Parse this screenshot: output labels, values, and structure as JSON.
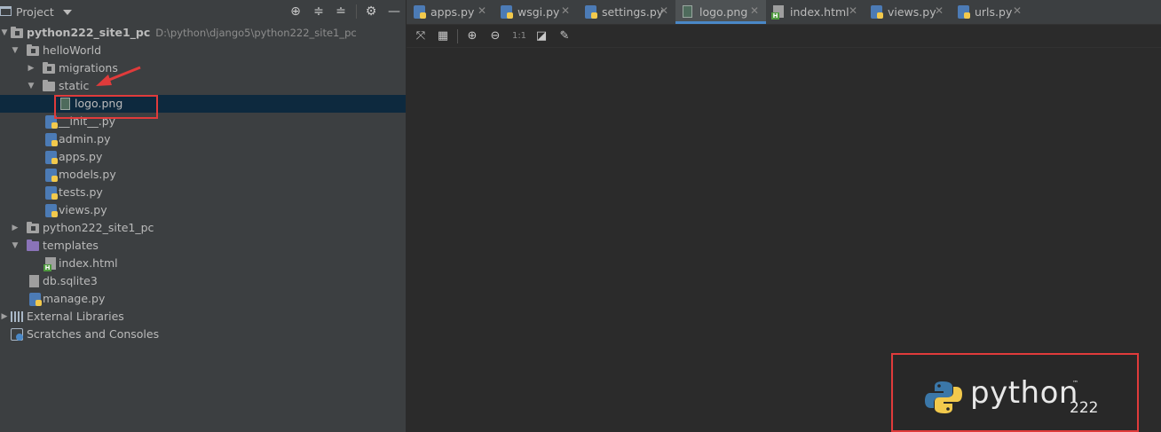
{
  "project_panel": {
    "title": "Project",
    "tree": {
      "root": {
        "label": "python222_site1_pc",
        "path": "D:\\python\\django5\\python222_site1_pc"
      },
      "hello_world": "helloWorld",
      "migrations": "migrations",
      "static": "static",
      "logo": "logo.png",
      "init": "__init__.py",
      "admin": "admin.py",
      "apps": "apps.py",
      "models": "models.py",
      "tests": "tests.py",
      "views": "views.py",
      "site_pkg": "python222_site1_pc",
      "templates": "templates",
      "index": "index.html",
      "db": "db.sqlite3",
      "manage": "manage.py",
      "external_libraries": "External Libraries",
      "scratches": "Scratches and Consoles"
    }
  },
  "editor": {
    "tabs": [
      {
        "label": "apps.py",
        "icon": "python-file-icon"
      },
      {
        "label": "wsgi.py",
        "icon": "python-file-icon"
      },
      {
        "label": "settings.py",
        "icon": "python-file-icon"
      },
      {
        "label": "logo.png",
        "icon": "image-file-icon",
        "active": true
      },
      {
        "label": "index.html",
        "icon": "html-file-icon"
      },
      {
        "label": "views.py",
        "icon": "python-file-icon"
      },
      {
        "label": "urls.py",
        "icon": "python-file-icon"
      }
    ],
    "toolbar": {
      "zoom_actual_label": "1:1"
    },
    "image": {
      "logo_word": "python",
      "logo_number": "222",
      "logo_tm": "™"
    }
  },
  "colors": {
    "accent": "#4a88c7",
    "highlight_box": "#e03b3b",
    "selection": "#0d293e"
  }
}
